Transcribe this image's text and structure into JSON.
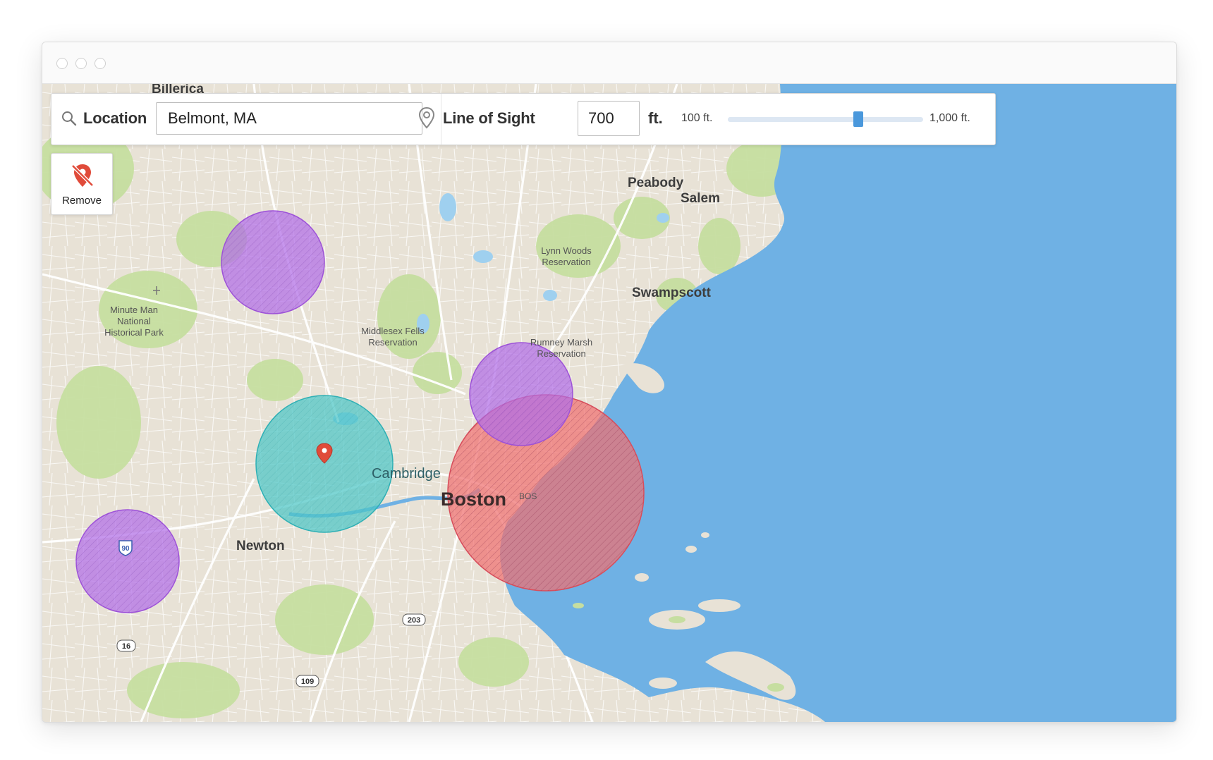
{
  "toolbar": {
    "location_label": "Location",
    "location_value": "Belmont, MA",
    "los_label": "Line of Sight",
    "los_value": "700",
    "unit": "ft.",
    "range_min_label": "100 ft.",
    "range_max_label": "1,000 ft.",
    "range_min": 100,
    "range_max": 1000,
    "slider_value": 700
  },
  "remove_button": {
    "label": "Remove",
    "icon": "remove-pin-icon"
  },
  "map": {
    "places": {
      "billerica": "Billerica",
      "peabody": "Peabody",
      "salem": "Salem",
      "swampscott": "Swampscott",
      "lynn_woods_1": "Lynn Woods",
      "lynn_woods_2": "Reservation",
      "minute_man_1": "Minute Man",
      "minute_man_2": "National",
      "minute_man_3": "Historical Park",
      "middlesex_1": "Middlesex Fells",
      "middlesex_2": "Reservation",
      "rumney_1": "Rumney Marsh",
      "rumney_2": "Reservation",
      "cambridge": "Cambridge",
      "boston": "Boston",
      "bos": "BOS",
      "newton": "Newton"
    },
    "shields": {
      "i90": "90",
      "r16": "16",
      "r203": "203",
      "r109": "109"
    },
    "colors": {
      "water": "#6fb1e4",
      "land": "#e8e2d6",
      "park": "#c6dea0",
      "zone_purple": "#b26ee8",
      "zone_cyan": "#4cc6c6",
      "zone_red": "#f07070",
      "pin": "#e04b3a"
    }
  }
}
